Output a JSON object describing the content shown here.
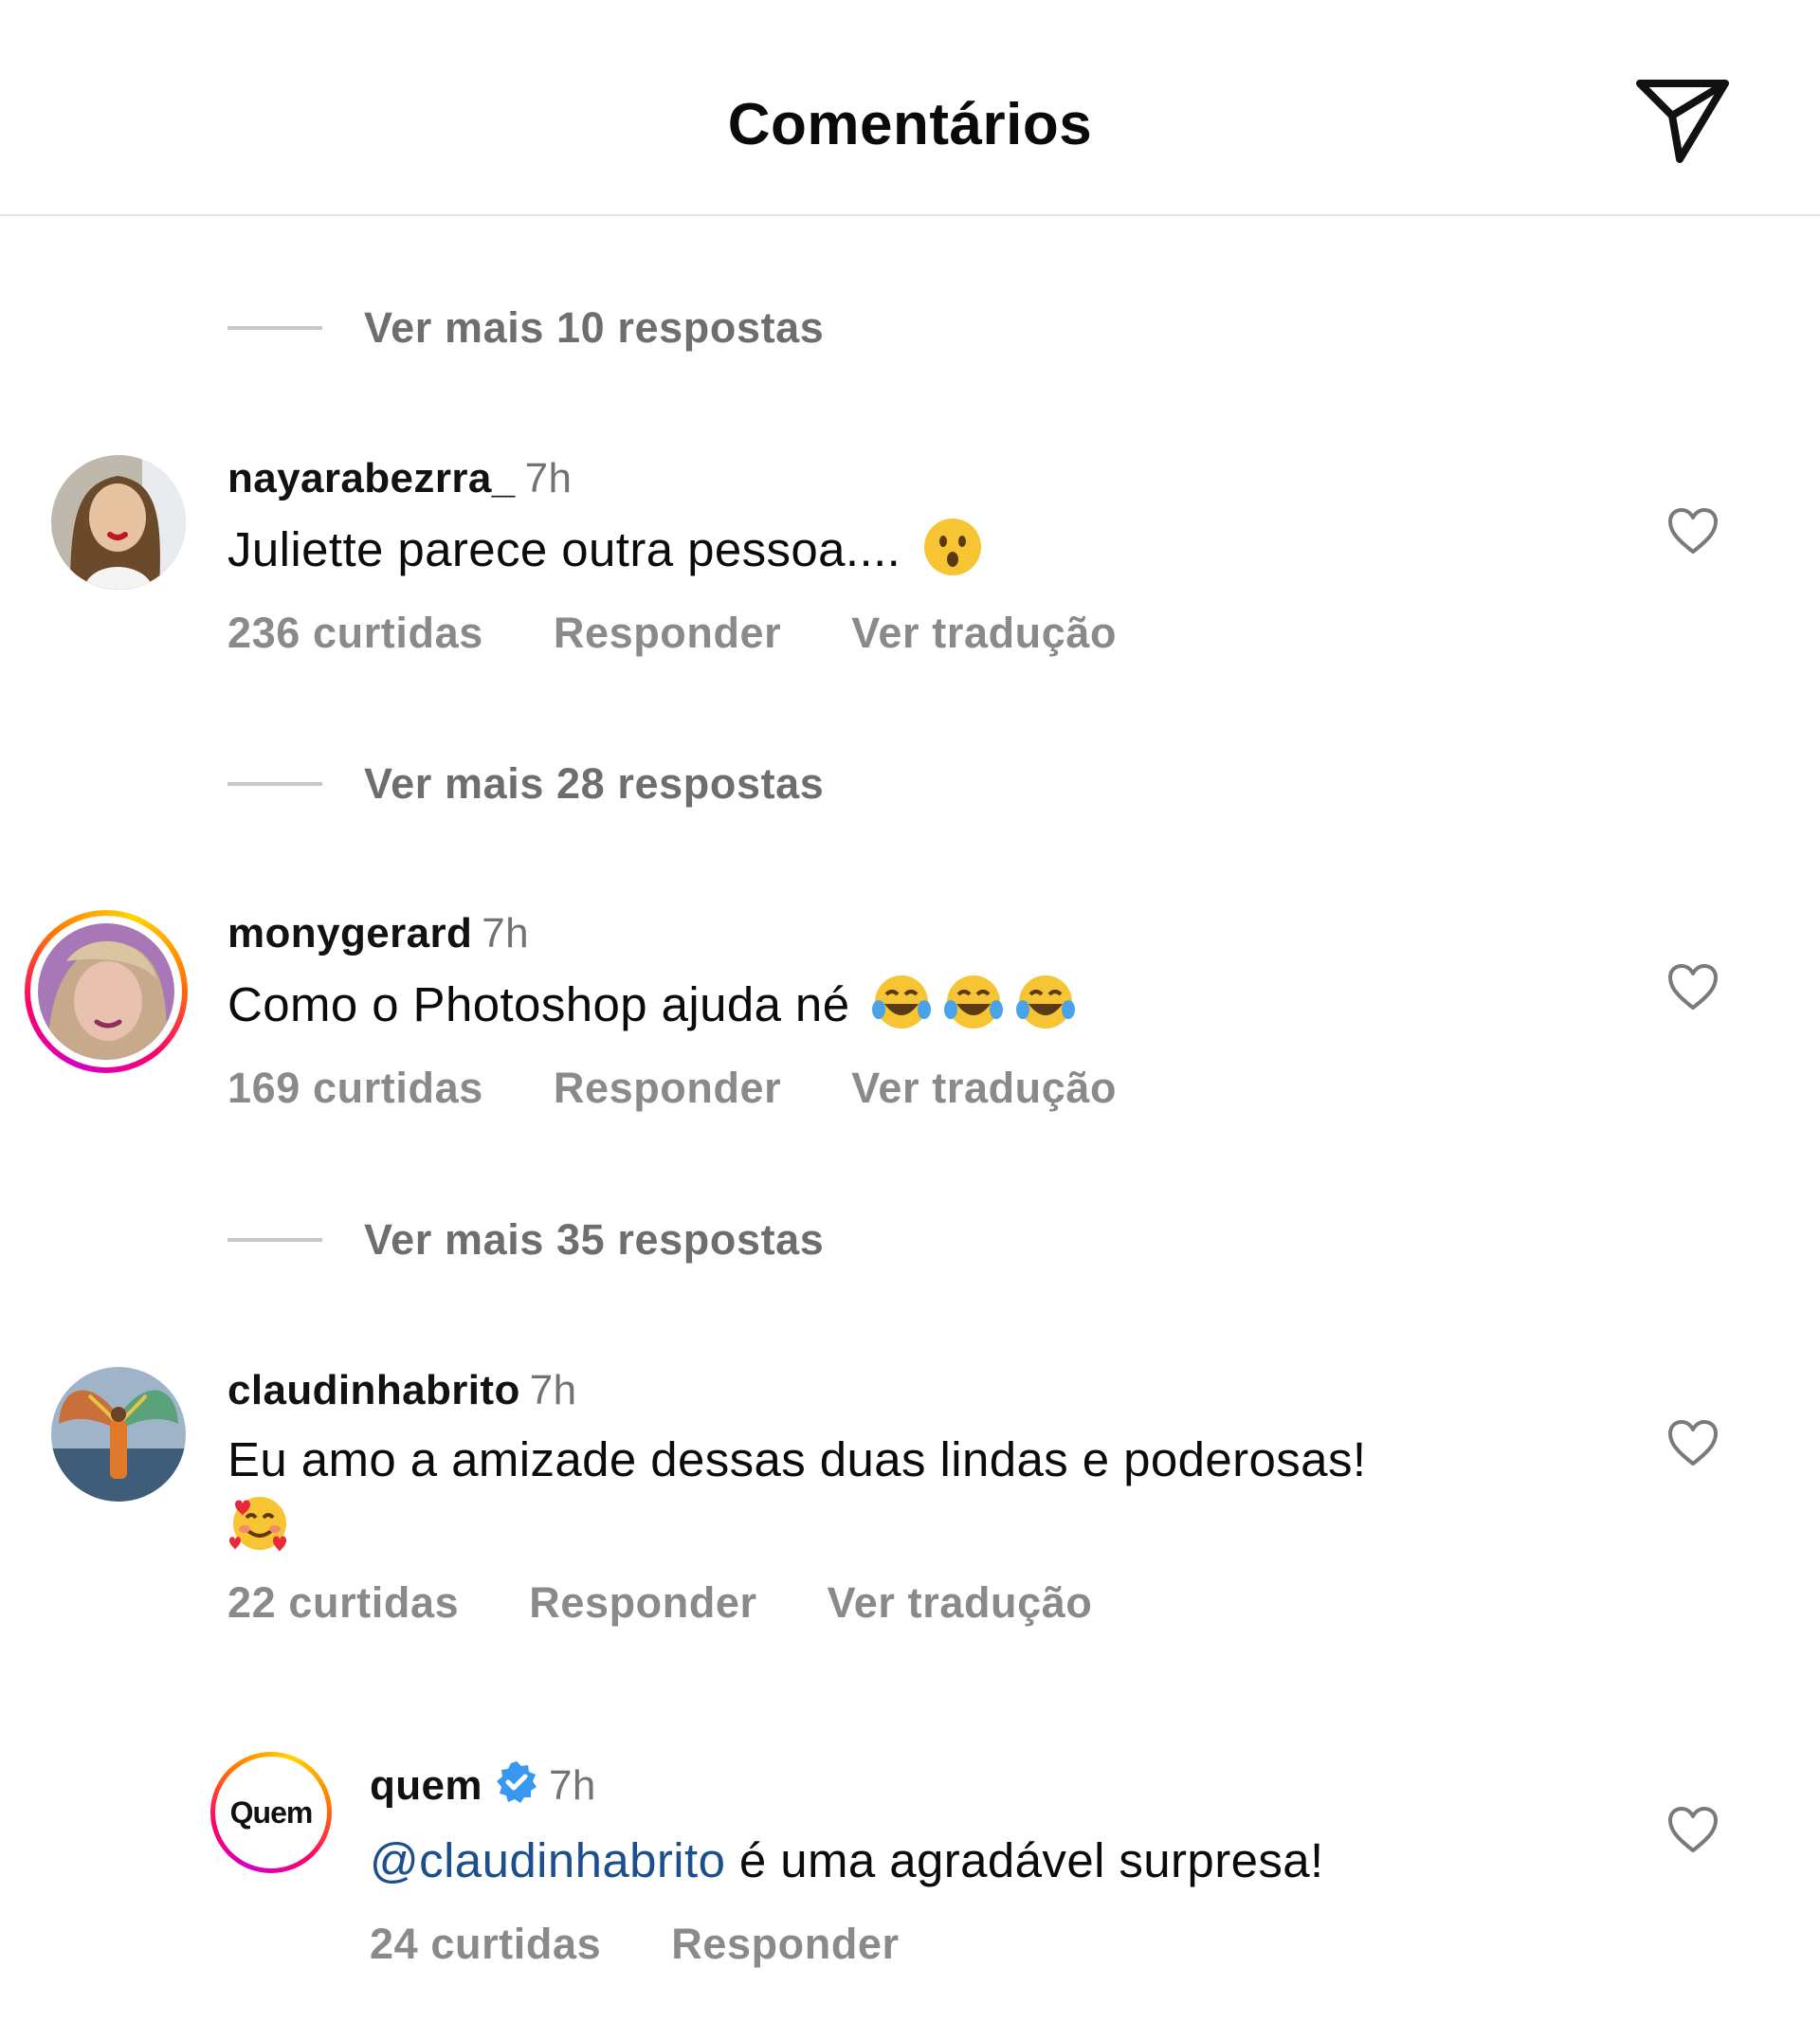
{
  "header": {
    "title": "Comentários"
  },
  "threads": [
    {
      "view_more": "Ver mais 10 respostas"
    },
    {
      "view_more": "Ver mais 28 respostas"
    },
    {
      "view_more": "Ver mais 35 respostas"
    }
  ],
  "comments": [
    {
      "username": "nayarabezrra_",
      "time": "7h",
      "text": "Juliette parece outra pessoa....",
      "emoji": "astonished-face-emoji",
      "likes": "236 curtidas",
      "reply": "Responder",
      "translate": "Ver tradução"
    },
    {
      "username": "monygerard",
      "time": "7h",
      "text": "Como o Photoshop ajuda né",
      "emoji": "tears-of-joy-emoji",
      "likes": "169 curtidas",
      "reply": "Responder",
      "translate": "Ver tradução"
    },
    {
      "username": "claudinhabrito",
      "time": "7h",
      "text": "Eu amo a amizade dessas duas lindas e poderosas!",
      "emoji": "smiling-face-with-hearts-emoji",
      "likes": "22 curtidas",
      "reply": "Responder",
      "translate": "Ver tradução"
    },
    {
      "username": "quem",
      "avatar_text": "Quem",
      "verified": true,
      "time": "7h",
      "mention": "@claudinhabrito",
      "text": " é uma agradável surpresa!",
      "likes": "24 curtidas",
      "reply": "Responder"
    }
  ],
  "colors": {
    "verified_badge": "#3897f0",
    "mention": "#1c4f8c",
    "secondary_text": "#8a8a8a"
  }
}
